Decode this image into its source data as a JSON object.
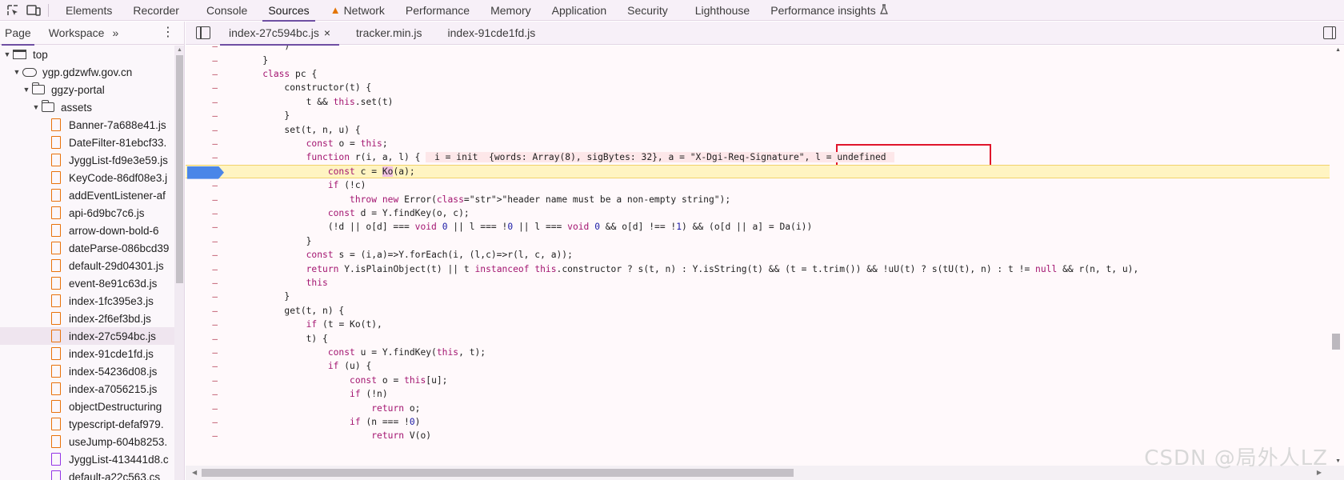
{
  "toolbar": {
    "tabs": [
      {
        "label": "Elements"
      },
      {
        "label": "Recorder"
      },
      {
        "label": "Console"
      },
      {
        "label": "Sources"
      },
      {
        "label": "Network"
      },
      {
        "label": "Performance"
      },
      {
        "label": "Memory"
      },
      {
        "label": "Application"
      },
      {
        "label": "Security"
      },
      {
        "label": "Lighthouse"
      },
      {
        "label": "Performance insights"
      }
    ],
    "active_tab": "Sources",
    "network_warning_icon": "warning-triangle-icon",
    "insights_icon": "flask-icon",
    "icons": [
      "inspect-element-icon",
      "device-toolbar-icon"
    ],
    "accent_color": "#6f4fa3"
  },
  "left_panel": {
    "tabs": [
      {
        "label": "Page"
      },
      {
        "label": "Workspace"
      }
    ],
    "more_label": "»",
    "tree": [
      {
        "label": "top",
        "depth": 0,
        "kind": "frame",
        "expanded": true
      },
      {
        "label": "ygp.gdzwfw.gov.cn",
        "depth": 1,
        "kind": "cloud",
        "expanded": true
      },
      {
        "label": "ggzy-portal",
        "depth": 2,
        "kind": "folder",
        "expanded": true
      },
      {
        "label": "assets",
        "depth": 3,
        "kind": "folder",
        "expanded": true
      },
      {
        "label": "Banner-7a688e41.js",
        "depth": 4,
        "kind": "file"
      },
      {
        "label": "DateFilter-81ebcf33.",
        "depth": 4,
        "kind": "file"
      },
      {
        "label": "JyggList-fd9e3e59.js",
        "depth": 4,
        "kind": "file"
      },
      {
        "label": "KeyCode-86df08e3.j",
        "depth": 4,
        "kind": "file"
      },
      {
        "label": "addEventListener-af",
        "depth": 4,
        "kind": "file"
      },
      {
        "label": "api-6d9bc7c6.js",
        "depth": 4,
        "kind": "file"
      },
      {
        "label": "arrow-down-bold-6",
        "depth": 4,
        "kind": "file"
      },
      {
        "label": "dateParse-086bcd39",
        "depth": 4,
        "kind": "file"
      },
      {
        "label": "default-29d04301.js",
        "depth": 4,
        "kind": "file"
      },
      {
        "label": "event-8e91c63d.js",
        "depth": 4,
        "kind": "file"
      },
      {
        "label": "index-1fc395e3.js",
        "depth": 4,
        "kind": "file"
      },
      {
        "label": "index-2f6ef3bd.js",
        "depth": 4,
        "kind": "file"
      },
      {
        "label": "index-27c594bc.js",
        "depth": 4,
        "kind": "file",
        "selected": true
      },
      {
        "label": "index-91cde1fd.js",
        "depth": 4,
        "kind": "file"
      },
      {
        "label": "index-54236d08.js",
        "depth": 4,
        "kind": "file"
      },
      {
        "label": "index-a7056215.js",
        "depth": 4,
        "kind": "file"
      },
      {
        "label": "objectDestructuring",
        "depth": 4,
        "kind": "file"
      },
      {
        "label": "typescript-defaf979.",
        "depth": 4,
        "kind": "file"
      },
      {
        "label": "useJump-604b8253.",
        "depth": 4,
        "kind": "file"
      },
      {
        "label": "JyggList-413441d8.c",
        "depth": 4,
        "kind": "file-css"
      },
      {
        "label": "default-a22c563.cs",
        "depth": 4,
        "kind": "file-css"
      }
    ]
  },
  "editor": {
    "tabs": [
      {
        "label": "index-27c594bc.js",
        "active": true,
        "closable": true
      },
      {
        "label": "tracker.min.js"
      },
      {
        "label": "index-91cde1fd.js"
      }
    ],
    "close_label": "×",
    "execution_line_index": 9,
    "gutter_marker": "–"
  },
  "code_lines": [
    "        )",
    "    }",
    "    class pc {",
    "        constructor(t) {",
    "            t && this.set(t)",
    "        }",
    "        set(t, n, u) {",
    "            const o = this;",
    "            function r(i, a, l) {  i = init  {words: Array(8), sigBytes: 32}, a = \"X-Dgi-Req-Signature\", l = undefined ",
    "                const c = Ko(a);",
    "                if (!c)",
    "                    throw new Error(\"header name must be a non-empty string\");",
    "                const d = Y.findKey(o, c);",
    "                (!d || o[d] === void 0 || l === !0 || l === void 0 && o[d] !== !1) && (o[d || a] = Da(i))",
    "            }",
    "            const s = (i,a)=>Y.forEach(i, (l,c)=>r(l, c, a));",
    "            return Y.isPlainObject(t) || t instanceof this.constructor ? s(t, n) : Y.isString(t) && (t = t.trim()) && !uU(t) ? s(tU(t), n) : t != null && r(n, t, u),",
    "            this",
    "        }",
    "        get(t, n) {",
    "            if (t = Ko(t),",
    "            t) {",
    "                const u = Y.findKey(this, t);",
    "                if (u) {",
    "                    const o = this[u];",
    "                    if (!n)",
    "                        return o;",
    "                    if (n === !0)",
    "                        return V(o)"
  ],
  "watermark": "CSDN @局外人LZ"
}
